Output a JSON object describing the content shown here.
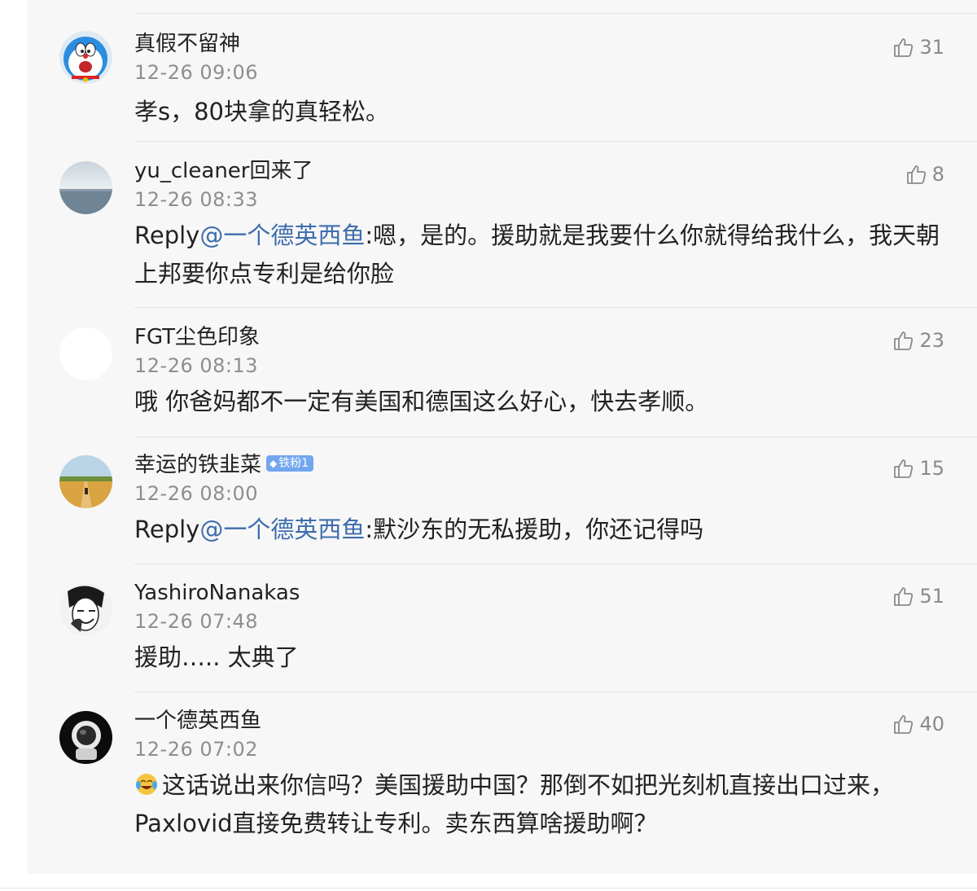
{
  "comments": [
    {
      "username": "真假不留神",
      "time": "12-26 09:06",
      "likes": "31",
      "text": "孝s，80块拿的真轻松。"
    },
    {
      "username": "yu_cleaner回来了",
      "time": "12-26 08:33",
      "likes": "8",
      "reply_prefix": "Reply",
      "mention": "@一个德英西鱼",
      "text": ":嗯，是的。援助就是我要什么你就得给我什么，我天朝上邦要你点专利是给你脸"
    },
    {
      "username": "FGT尘色印象",
      "time": "12-26 08:13",
      "likes": "23",
      "text": "哦 你爸妈都不一定有美国和德国这么好心，快去孝顺。"
    },
    {
      "username": "幸运的铁韭菜",
      "badge": "铁粉1",
      "time": "12-26 08:00",
      "likes": "15",
      "reply_prefix": "Reply",
      "mention": "@一个德英西鱼",
      "text": ":默沙东的无私援助，你还记得吗"
    },
    {
      "username": "YashiroNanakas",
      "time": "12-26 07:48",
      "likes": "51",
      "text": "援助….. 太典了"
    },
    {
      "username": "一个德英西鱼",
      "time": "12-26 07:02",
      "likes": "40",
      "emoji": "laughing-crying-emoji",
      "text": "这话说出来你信吗？美国援助中国？那倒不如把光刻机直接出口过来，Paxlovid直接免费转让专利。卖东西算啥援助啊？"
    }
  ],
  "colors": {
    "panel_bg": "#f7f7f7",
    "mention": "#3d6dae",
    "meta": "#8e8e8e",
    "badge": "#72a6ef"
  }
}
